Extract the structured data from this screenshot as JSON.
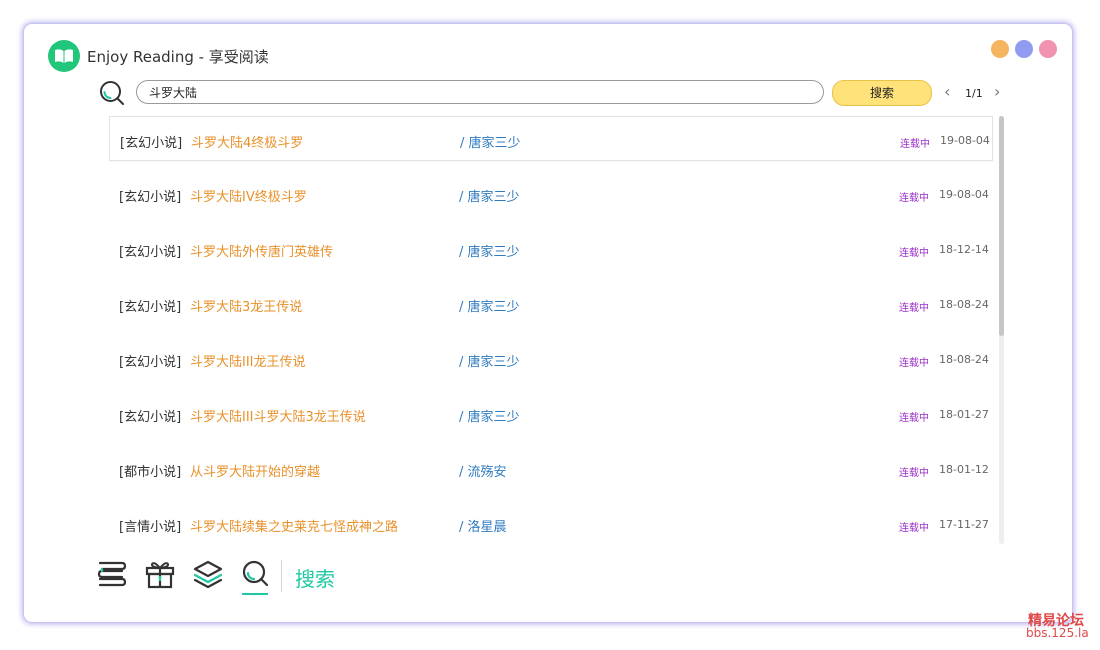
{
  "app": {
    "title": "Enjoy Reading - 享受阅读",
    "logo_icon": "open-book-icon"
  },
  "window_controls": [
    {
      "name": "minimize",
      "color": "#f5b560"
    },
    {
      "name": "maximize",
      "color": "#8f9cf0"
    },
    {
      "name": "close",
      "color": "#f193b0"
    }
  ],
  "search": {
    "value": "斗罗大陆",
    "button_label": "搜索",
    "icon": "search-icon"
  },
  "pager": {
    "prev": "‹",
    "text": "1/1",
    "next": "›"
  },
  "results": [
    {
      "category": "[玄幻小说]",
      "title": "斗罗大陆4终极斗罗",
      "author": "/  唐家三少",
      "status": "连载中",
      "date": "19-08-04"
    },
    {
      "category": "[玄幻小说]",
      "title": "斗罗大陆IV终极斗罗",
      "author": "/  唐家三少",
      "status": "连载中",
      "date": "19-08-04"
    },
    {
      "category": "[玄幻小说]",
      "title": "斗罗大陆外传唐门英雄传",
      "author": "/  唐家三少",
      "status": "连载中",
      "date": "18-12-14"
    },
    {
      "category": "[玄幻小说]",
      "title": "斗罗大陆3龙王传说",
      "author": "/  唐家三少",
      "status": "连载中",
      "date": "18-08-24"
    },
    {
      "category": "[玄幻小说]",
      "title": "斗罗大陆III龙王传说",
      "author": "/  唐家三少",
      "status": "连载中",
      "date": "18-08-24"
    },
    {
      "category": "[玄幻小说]",
      "title": "斗罗大陆III斗罗大陆3龙王传说",
      "author": "/  唐家三少",
      "status": "连载中",
      "date": "18-01-27"
    },
    {
      "category": "[都市小说]",
      "title": "从斗罗大陆开始的穿越",
      "author": "/  流殇安",
      "status": "连载中",
      "date": "18-01-12"
    },
    {
      "category": "[言情小说]",
      "title": "斗罗大陆续集之史莱克七怪成神之路",
      "author": "/  洛星晨",
      "status": "连载中",
      "date": "17-11-27"
    }
  ],
  "bottom_nav": {
    "items": [
      {
        "name": "bookshelf",
        "icon": "bookshelf-icon"
      },
      {
        "name": "gift",
        "icon": "gift-icon"
      },
      {
        "name": "layers",
        "icon": "layers-icon"
      },
      {
        "name": "search",
        "icon": "search-icon",
        "active": true
      }
    ],
    "active_label": "搜索"
  },
  "colors": {
    "accent": "#1ec9a3",
    "title_orange": "#e8912a",
    "author_blue": "#2f7bbf",
    "status_purple": "#9b30c8",
    "search_button": "#ffe27a"
  },
  "watermark": {
    "line1": "精易论坛",
    "line2": "bbs.125.la"
  }
}
